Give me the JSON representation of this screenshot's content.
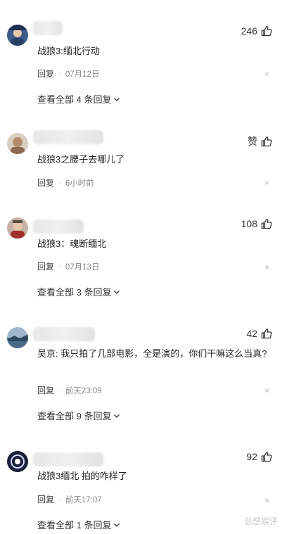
{
  "comments": [
    {
      "likes": "246",
      "text": "战狼3:缅北行动",
      "reply": "回复",
      "time": "07月12日",
      "close": "×",
      "view_all": "查看全部 4 条回复"
    },
    {
      "likes": "赞",
      "text": "战狼3之腰子去哪儿了",
      "reply": "回复",
      "time": "6小时前",
      "close": "×"
    },
    {
      "likes": "108",
      "text": "战狼3：魂断缅北",
      "reply": "回复",
      "time": "07月13日",
      "close": "×",
      "view_all": "查看全部 3 条回复"
    },
    {
      "likes": "42",
      "text": "吴京: 我只拍了几部电影，全是演的，你们干嘛这么当真?",
      "reply": "回复",
      "time": "前天23:09",
      "close": "×",
      "view_all": "查看全部 9 条回复"
    },
    {
      "likes": "92",
      "text": "战狼3缅北 拍的咋样了",
      "reply": "回复",
      "time": "前天17:07",
      "close": "×",
      "view_all": "查看全部 1 条回复"
    }
  ],
  "separator": "·",
  "watermark": "总想娱评",
  "icons": {
    "like": "thumbs-up-icon",
    "close": "close-icon",
    "chevron": "chevron-down-icon"
  }
}
